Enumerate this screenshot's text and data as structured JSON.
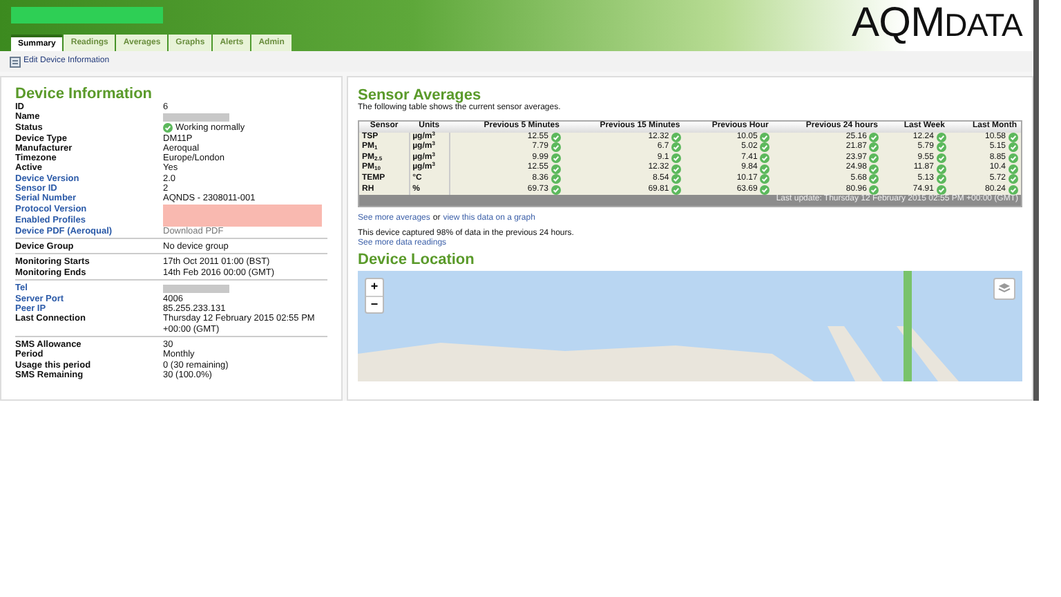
{
  "header": {
    "logo_main": "AQM",
    "logo_suffix": "DATA"
  },
  "tabs": [
    {
      "label": "Summary",
      "selected": true
    },
    {
      "label": "Readings",
      "selected": false
    },
    {
      "label": "Averages",
      "selected": false
    },
    {
      "label": "Graphs",
      "selected": false
    },
    {
      "label": "Alerts",
      "selected": false
    },
    {
      "label": "Admin",
      "selected": false
    }
  ],
  "toolbar": {
    "edit_link": "Edit Device Information"
  },
  "device_info": {
    "title": "Device Information",
    "groups": [
      [
        {
          "label": "ID",
          "link": false,
          "kind": "text",
          "value": "6"
        },
        {
          "label": "Name",
          "link": false,
          "kind": "redacted"
        },
        {
          "label": "Status",
          "link": false,
          "kind": "status",
          "value": "Working normally"
        },
        {
          "label": "Device Type",
          "link": false,
          "kind": "text",
          "value": "DM11P"
        },
        {
          "label": "Manufacturer",
          "link": false,
          "kind": "text",
          "value": "Aeroqual"
        },
        {
          "label": "Timezone",
          "link": false,
          "kind": "text",
          "value": "Europe/London"
        },
        {
          "label": "Active",
          "link": false,
          "kind": "text",
          "value": "Yes"
        },
        {
          "label": "Device Version",
          "link": true,
          "kind": "text",
          "value": "2.0"
        },
        {
          "label": "Sensor ID",
          "link": true,
          "kind": "text",
          "value": "2"
        },
        {
          "label": "Serial Number",
          "link": true,
          "kind": "text",
          "value": "AQNDS - 2308011-001"
        },
        {
          "label": "Protocol Version",
          "link": true,
          "kind": "masked"
        },
        {
          "label": "Enabled Profiles",
          "link": true,
          "kind": "masked"
        },
        {
          "label": "Device PDF (Aeroqual)",
          "link": true,
          "kind": "download",
          "value": "Download PDF"
        }
      ],
      [
        {
          "label": "Device Group",
          "link": false,
          "kind": "text",
          "value": "No device group"
        }
      ],
      [
        {
          "label": "Monitoring Starts",
          "link": false,
          "kind": "text",
          "value": "17th Oct 2011 01:00 (BST)"
        },
        {
          "label": "Monitoring Ends",
          "link": false,
          "kind": "text",
          "value": "14th Feb 2016 00:00 (GMT)"
        }
      ],
      [
        {
          "label": "Tel",
          "link": true,
          "kind": "redacted"
        },
        {
          "label": "Server Port",
          "link": true,
          "kind": "text",
          "value": "4006"
        },
        {
          "label": "Peer IP",
          "link": true,
          "kind": "text",
          "value": "85.255.233.131"
        },
        {
          "label": "Last Connection",
          "link": false,
          "kind": "text",
          "value": "Thursday 12 February 2015 02:55 PM +00:00 (GMT)"
        }
      ],
      [
        {
          "label": "SMS Allowance",
          "link": false,
          "kind": "text",
          "value": "30"
        },
        {
          "label": "Period",
          "link": false,
          "kind": "text",
          "value": "Monthly"
        },
        {
          "label": "Usage this period",
          "link": false,
          "kind": "text",
          "value": "0 (30 remaining)"
        },
        {
          "label": "SMS Remaining",
          "link": false,
          "kind": "text",
          "value": "30 (100.0%)"
        }
      ]
    ]
  },
  "sensor_averages": {
    "title": "Sensor Averages",
    "intro": "The following table shows the current sensor averages.",
    "columns": [
      "Sensor",
      "Units",
      "Previous 5 Minutes",
      "Previous 15 Minutes",
      "Previous Hour",
      "Previous 24 hours",
      "Last Week",
      "Last Month"
    ],
    "rows": [
      {
        "sensor": "TSP",
        "units": "µg/m$^{3}$",
        "values": [
          "12.55",
          "12.32",
          "10.05",
          "25.16",
          "12.24",
          "10.58"
        ]
      },
      {
        "sensor": "PM$_{1}$",
        "units": "µg/m$^{3}$",
        "values": [
          "7.79",
          "6.7",
          "5.02",
          "21.87",
          "5.79",
          "5.15"
        ]
      },
      {
        "sensor": "PM$_{2.5}$",
        "units": "µg/m$^{3}$",
        "values": [
          "9.99",
          "9.1",
          "7.41",
          "23.97",
          "9.55",
          "8.85"
        ]
      },
      {
        "sensor": "PM$_{10}$",
        "units": "µg/m$^{3}$",
        "values": [
          "12.55",
          "12.32",
          "9.84",
          "24.98",
          "11.87",
          "10.4"
        ]
      },
      {
        "sensor": "TEMP",
        "units": "°C",
        "values": [
          "8.36",
          "8.54",
          "10.17",
          "5.68",
          "5.13",
          "5.72"
        ]
      },
      {
        "sensor": "RH",
        "units": "%",
        "values": [
          "69.73",
          "69.81",
          "63.69",
          "80.96",
          "74.91",
          "80.24"
        ]
      }
    ],
    "last_update": "Last update: Thursday 12 February 2015 02:55 PM +00:00 (GMT)",
    "more_link": "See more averages",
    "or": "or",
    "graph_link": "view this data on a graph",
    "capture_note": "This device captured 98% of data in the previous 24 hours.",
    "readings_link": "See more data readings"
  },
  "location": {
    "title": "Device Location",
    "zoom_in": "+",
    "zoom_out": "−"
  }
}
